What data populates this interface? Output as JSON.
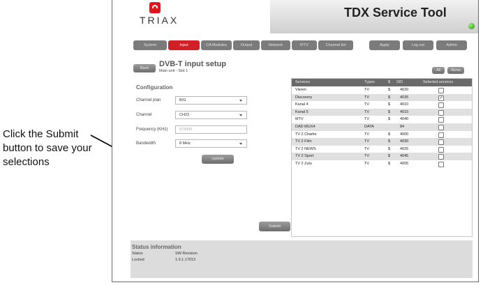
{
  "callout": {
    "text": "Click the Submit button to save your selections"
  },
  "app": {
    "title": "TDX Service Tool",
    "logo_text": "TRIAX"
  },
  "nav": {
    "tabs": [
      "System",
      "Input",
      "CA Modules",
      "Output",
      "Network",
      "IPTV",
      "Channel list"
    ],
    "active_tab": "Input",
    "right_buttons": [
      "Apply",
      "Log out",
      "Admin"
    ]
  },
  "page": {
    "back_label": "Back",
    "title": "DVB-T input setup",
    "subtitle": "Main unit - Slot 1"
  },
  "config": {
    "heading": "Configuration",
    "channel_plan_label": "Channel plan",
    "channel_plan_value": "B/G",
    "channel_label": "Channel",
    "channel_value": "CH23",
    "frequency_label": "Frequency (KHz)",
    "frequency_placeholder": "573000",
    "bandwidth_label": "Bandwidth",
    "bandwidth_value": "8 MHz",
    "update_label": "Update"
  },
  "table": {
    "all_label": "All",
    "none_label": "None",
    "headers": [
      "Services",
      "Types",
      "$",
      "SID",
      "Selected services"
    ],
    "rows": [
      {
        "service": "Vieren",
        "type": "TV",
        "flag": "$",
        "sid": "4020",
        "selected": false
      },
      {
        "service": "Discovery",
        "type": "TV",
        "flag": "$",
        "sid": "4035",
        "selected": true
      },
      {
        "service": "Kanal 4",
        "type": "TV",
        "flag": "$",
        "sid": "4010",
        "selected": false
      },
      {
        "service": "Kanal 5",
        "type": "TV",
        "flag": "$",
        "sid": "4015",
        "selected": false
      },
      {
        "service": "MTV",
        "type": "TV",
        "flag": "$",
        "sid": "4040",
        "selected": false
      },
      {
        "service": "DAD MUX4",
        "type": "DATA",
        "flag": "",
        "sid": "84",
        "selected": false
      },
      {
        "service": "TV 2 Charlie",
        "type": "TV",
        "flag": "$",
        "sid": "4000",
        "selected": false
      },
      {
        "service": "TV 2 Film",
        "type": "TV",
        "flag": "$",
        "sid": "4030",
        "selected": false
      },
      {
        "service": "TV 2 NEWS",
        "type": "TV",
        "flag": "$",
        "sid": "4025",
        "selected": false
      },
      {
        "service": "TV 2 Sport",
        "type": "TV",
        "flag": "$",
        "sid": "4045",
        "selected": false
      },
      {
        "service": "TV 2 Zulu",
        "type": "TV",
        "flag": "$",
        "sid": "4005",
        "selected": false
      }
    ]
  },
  "submit_label": "Submit",
  "status": {
    "heading": "Status information",
    "status_label": "Status",
    "status_value": "SW-Revision",
    "locked_label": "Locked",
    "locked_value": "1.9.1.17013"
  },
  "colors": {
    "accent": "#d21f26",
    "status_led": "#2fb51f"
  }
}
